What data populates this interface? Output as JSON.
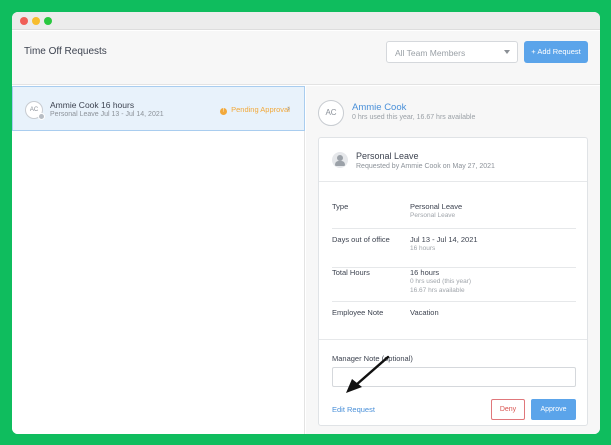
{
  "header": {
    "title": "Time Off Requests",
    "team_filter": "All Team Members",
    "add_button": "+ Add Request"
  },
  "list": {
    "items": [
      {
        "initials": "AC",
        "name": "Ammie Cook 16 hours",
        "subtitle": "Personal Leave Jul 13 - Jul 14, 2021",
        "status": "Pending Approval",
        "status_icon": "!"
      }
    ]
  },
  "detail": {
    "initials": "AC",
    "name": "Ammie Cook",
    "hours_summary": "0 hrs used this year, 16.67 hrs available",
    "request_title": "Personal Leave",
    "requested_by": "Requested by Ammie Cook on May 27, 2021",
    "fields": [
      {
        "label": "Type",
        "value": "Personal Leave",
        "notes": [
          "Personal Leave"
        ]
      },
      {
        "label": "Days out of office",
        "value": "Jul 13 - Jul 14, 2021",
        "notes": [
          "16 hours"
        ]
      },
      {
        "label": "Total Hours",
        "value": "16 hours",
        "notes": [
          "0 hrs used (this year)",
          "16.67 hrs available"
        ]
      },
      {
        "label": "Employee Note",
        "value": "Vacation",
        "notes": []
      }
    ],
    "manager_note_label": "Manager Note (optional)",
    "manager_note_value": "",
    "edit_link": "Edit Request",
    "deny_button": "Deny",
    "approve_button": "Approve"
  },
  "colors": {
    "background": "#0fbd5e",
    "accent": "#5ba4ea",
    "link": "#4a90d9",
    "pending": "#f2a93b",
    "deny": "#d9534f"
  },
  "icons": [
    "close-dot-icon",
    "minimize-dot-icon",
    "maximize-dot-icon",
    "caret-down-icon",
    "warning-icon",
    "chevron-right-icon",
    "user-icon",
    "arrow-annotation-icon"
  ]
}
